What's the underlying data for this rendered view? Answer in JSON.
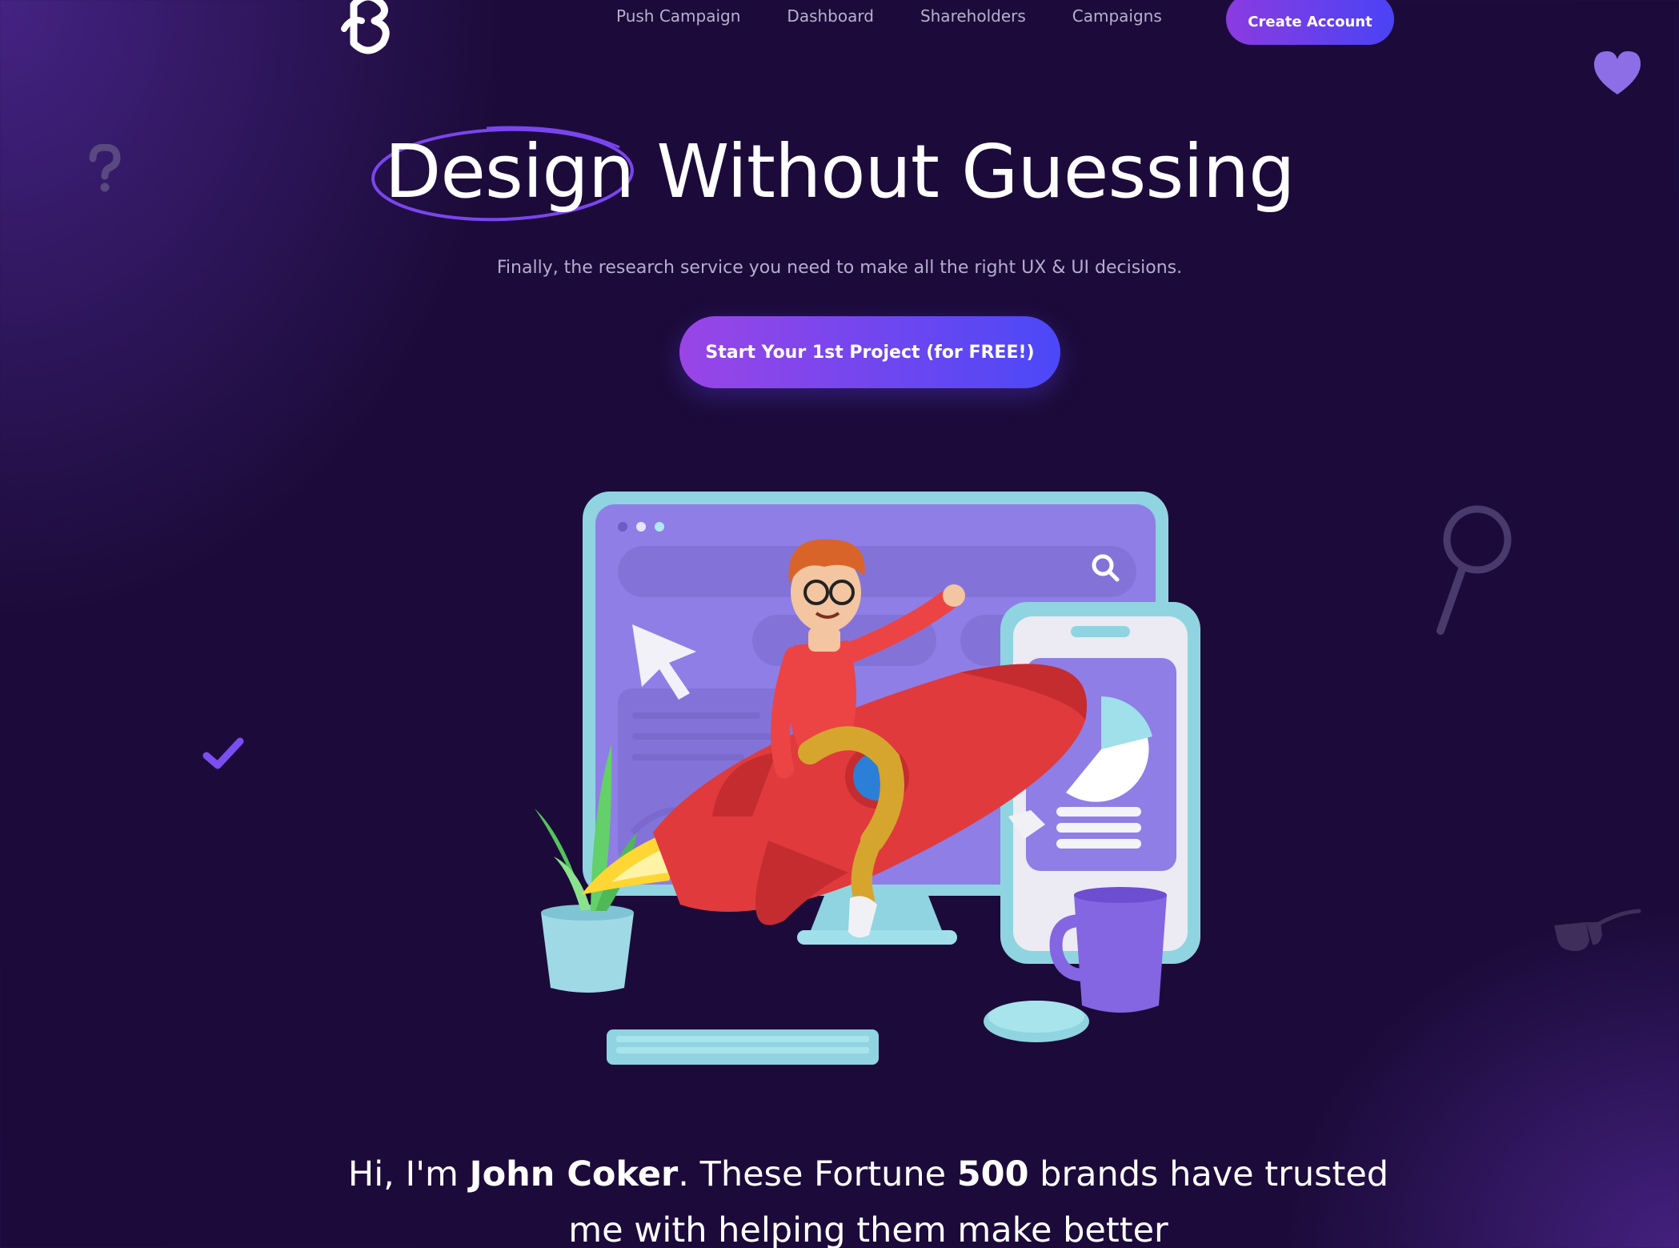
{
  "nav": {
    "logo_icon": "brand-logo-icon",
    "links": [
      {
        "label": "Push Campaign"
      },
      {
        "label": "Dashboard"
      },
      {
        "label": "Shareholders"
      },
      {
        "label": "Campaigns"
      }
    ],
    "create_account_label": "Create Account"
  },
  "hero": {
    "title_highlight": "Design",
    "title_rest": " Without Guessing",
    "subtitle": "Finally, the research service you need to make all the right UX & UI decisions.",
    "cta_label": "Start Your 1st Project (for FREE!)"
  },
  "illustration": {
    "icon": "rocket-developer-illustration"
  },
  "decorations": {
    "question": "question-mark-icon",
    "heart": "heart-icon",
    "check": "checkmark-icon",
    "magnifier": "magnifier-icon",
    "glasses": "glasses-icon"
  },
  "intro": {
    "part1": "Hi, I'm ",
    "name": "John Coker",
    "part2": ". These Fortune ",
    "number": "500",
    "part3": "  brands have trusted",
    "line2": "me with helping them make better"
  },
  "colors": {
    "background": "#1c0b3a",
    "accent_start": "#9a45e6",
    "accent_end": "#4b48f7",
    "muted_text": "#b5acd0"
  }
}
